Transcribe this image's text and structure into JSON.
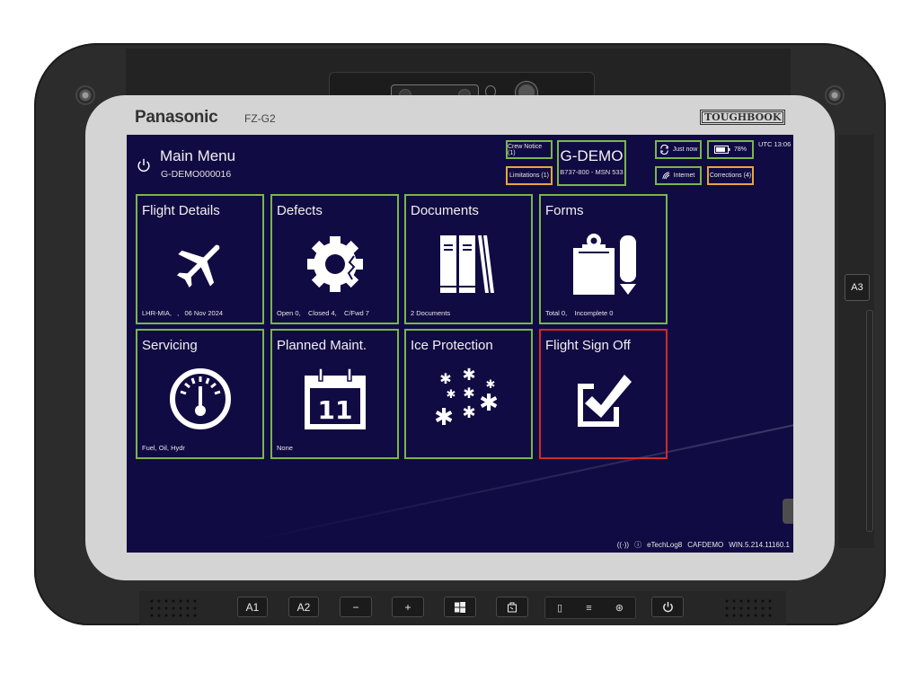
{
  "device": {
    "brand": "Panasonic",
    "model": "FZ-G2",
    "series_badge": "TOUGHBOOK",
    "side_button": "A3",
    "bottom_buttons": [
      {
        "id": "a1",
        "label": "A1"
      },
      {
        "id": "a2",
        "label": "A2"
      },
      {
        "id": "volume-down",
        "label": "−"
      },
      {
        "id": "volume-up",
        "label": "+"
      },
      {
        "id": "windows",
        "label": "windows-icon"
      },
      {
        "id": "rotate",
        "label": "rotate-icon"
      },
      {
        "id": "power",
        "label": "power-icon"
      }
    ],
    "status_leds": [
      "battery-led-icon",
      "storage-led-icon",
      "wireless-led-icon"
    ]
  },
  "header": {
    "title": "Main Menu",
    "subtitle": "G-DEMO000016",
    "registration": "G-DEMO",
    "aircraft": "B737-800 - MSN 533",
    "crew_notice": "Crew Notice (1)",
    "limitations": "Limitations (1)",
    "sync": "Just now",
    "connection": "Internet",
    "battery": "78%",
    "corrections": "Corrections (4)",
    "utc": "UTC 13:06"
  },
  "colors": {
    "background": "#110b43",
    "tile_ok_border": "#7ab648",
    "tile_alert_border": "#d12a2a",
    "chip_warn_border": "#e8a53a"
  },
  "tiles": [
    {
      "title": "Flight Details",
      "footer": "LHR-MIA,   ,   06 Nov 2024",
      "status": "ok"
    },
    {
      "title": "Defects",
      "footer": "Open 0,    Closed 4,    C/Fwd 7",
      "status": "ok"
    },
    {
      "title": "Documents",
      "footer": "2 Documents",
      "status": "ok"
    },
    {
      "title": "Forms",
      "footer": "Total 0,    Incomplete 0",
      "status": "ok"
    },
    {
      "title": "Servicing",
      "footer": "Fuel, Oil, Hydr",
      "status": "ok"
    },
    {
      "title": "Planned Maint.",
      "footer": "None",
      "status": "ok",
      "calendar_day": "11"
    },
    {
      "title": "Ice Protection",
      "footer": "",
      "status": "ok"
    },
    {
      "title": "Flight Sign Off",
      "footer": "",
      "status": "alert"
    }
  ],
  "statusbar": {
    "app": "eTechLog8",
    "operator": "CAFDEMO",
    "version": "WIN.5.214.11160.1"
  }
}
